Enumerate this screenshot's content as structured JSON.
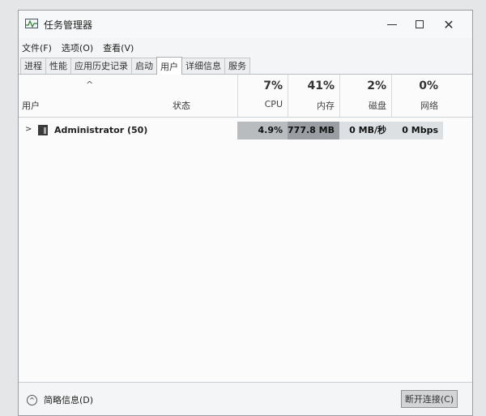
{
  "window": {
    "title": "任务管理器",
    "controls": {
      "minimize": "—",
      "maximize": "□",
      "close": "✕"
    }
  },
  "menu": [
    "文件(F)",
    "选项(O)",
    "查看(V)"
  ],
  "tabs": [
    {
      "label": "进程",
      "active": false
    },
    {
      "label": "性能",
      "active": false
    },
    {
      "label": "应用历史记录",
      "active": false
    },
    {
      "label": "启动",
      "active": false
    },
    {
      "label": "用户",
      "active": true
    },
    {
      "label": "详细信息",
      "active": false
    },
    {
      "label": "服务",
      "active": false
    }
  ],
  "table": {
    "sort_indicator": "^",
    "columns": {
      "user": "用户",
      "status": "状态",
      "cpu": {
        "percent": "7%",
        "label": "CPU"
      },
      "memory": {
        "percent": "41%",
        "label": "内存"
      },
      "disk": {
        "percent": "2%",
        "label": "磁盘"
      },
      "network": {
        "percent": "0%",
        "label": "网络"
      }
    },
    "rows": [
      {
        "expander": ">",
        "user": "Administrator (50)",
        "status": "",
        "cpu": "4.9%",
        "memory": "777.8 MB",
        "disk": "0 MB/秒",
        "network": "0 Mbps"
      }
    ]
  },
  "footer": {
    "fewer_details": "简略信息(D)",
    "disconnect": "断开连接(C)"
  },
  "colors": {
    "cpu_cell": "#b9bcbf",
    "memory_cell": "#9a9da1",
    "disk_cell": "#dde0e2",
    "network_cell": "#dde0e2"
  }
}
